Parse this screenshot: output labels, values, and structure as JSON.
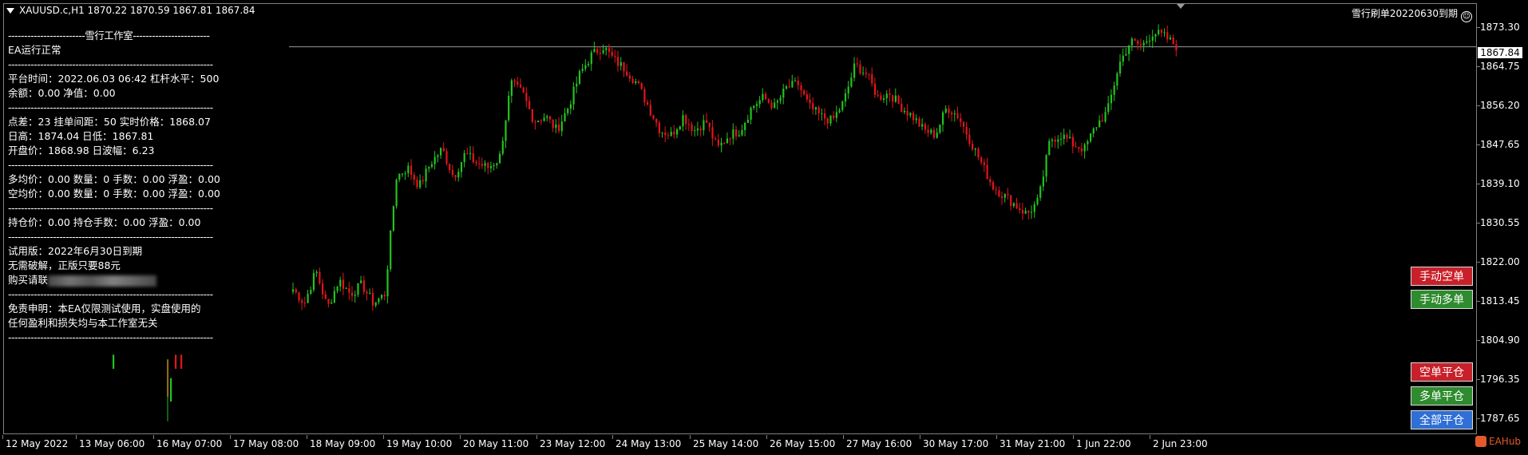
{
  "header": {
    "symbol_line": "XAUUSD.c,H1  1870.22 1870.59 1867.81 1867.84"
  },
  "top_right": {
    "text": "雪行刷单20220630到期"
  },
  "info_panel": {
    "separator_title": "------------------------雪行工作室------------------------",
    "status": "EA运行正常",
    "separator": "----------------------------------------------------------------",
    "platform_time": "平台时间：2022.06.03 06:42     杠杆水平：500",
    "balance": "余额：0.00   净值：0.00",
    "spread": "点差：23 挂单间距：50 实时价格：1868.07",
    "day_hl": "日高：1874.04   日低：1867.81",
    "open_range": "开盘价：1868.98   日波幅：6.23",
    "long_avg": "多均价：0.00   数量：0   手数：0.00   浮盈：0.00",
    "short_avg": "空均价：0.00   数量：0   手数：0.00   浮盈：0.00",
    "position": "持仓价：0.00   持仓手数：0.00   浮盈：0.00",
    "trial": "试用版：2022年6月30日到期",
    "no_crack": "无需破解，正版只要88元",
    "contact": "购买请联",
    "disclaimer1": "免责申明：本EA仅限测试使用，实盘使用的",
    "disclaimer2": "任何盈利和损失均与本工作室无关"
  },
  "price_axis": {
    "ticks": [
      "1873.30",
      "1864.75",
      "1856.20",
      "1847.65",
      "1839.10",
      "1830.55",
      "1822.00",
      "1813.45",
      "1804.90",
      "1796.35",
      "1787.65"
    ],
    "current_price": "1867.84"
  },
  "time_axis": {
    "ticks": [
      "12 May 2022",
      "13 May 06:00",
      "16 May 07:00",
      "17 May 08:00",
      "18 May 09:00",
      "19 May 10:00",
      "20 May 11:00",
      "23 May 12:00",
      "24 May 13:00",
      "25 May 14:00",
      "26 May 15:00",
      "27 May 16:00",
      "30 May 17:00",
      "31 May 21:00",
      "1 Jun 22:00",
      "2 Jun 23:00"
    ]
  },
  "buttons": {
    "manual_sell": "手动空单",
    "manual_buy": "手动多单",
    "close_sell": "空单平仓",
    "close_buy": "多单平仓",
    "close_all": "全部平仓"
  },
  "logo": {
    "text": "EAHub"
  },
  "colors": {
    "bull": "#22c41e",
    "bear": "#e5141b",
    "red_button": "#c8202a",
    "green_button": "#2e8b2e",
    "blue_button": "#2f6fd6"
  },
  "chart_data": {
    "type": "candlestick",
    "symbol": "XAUUSD.c",
    "timeframe": "H1",
    "ylim": [
      1785.0,
      1877.0
    ],
    "close_path": [
      1816,
      1813,
      1820,
      1812,
      1818,
      1815,
      1817,
      1813,
      1815,
      1840,
      1842,
      1838,
      1843,
      1846,
      1840,
      1845,
      1843,
      1842,
      1844,
      1860,
      1858,
      1852,
      1853,
      1850,
      1855,
      1862,
      1866,
      1868,
      1865,
      1863,
      1860,
      1855,
      1850,
      1849,
      1853,
      1850,
      1852,
      1846,
      1849,
      1850,
      1855,
      1857,
      1855,
      1859,
      1860,
      1855,
      1853,
      1852,
      1856,
      1864,
      1862,
      1857,
      1858,
      1855,
      1853,
      1850,
      1849,
      1855,
      1853,
      1848,
      1843,
      1838,
      1836,
      1834,
      1832,
      1835,
      1848,
      1849,
      1847,
      1846,
      1851,
      1854,
      1864,
      1869,
      1868,
      1871,
      1870,
      1868
    ],
    "last_price": 1867.84
  }
}
